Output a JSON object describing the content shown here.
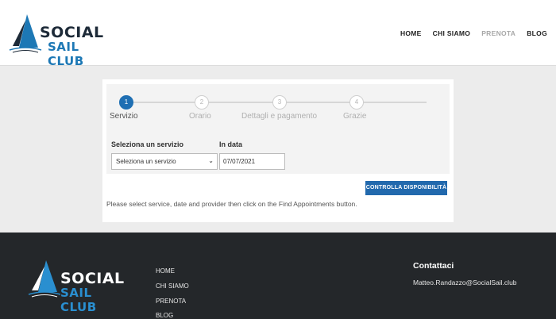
{
  "header": {
    "logo_line1": "SOCIAL",
    "logo_line2": "SAIL CLUB",
    "nav": [
      "HOME",
      "CHI SIAMO",
      "PRENOTA",
      "BLOG"
    ],
    "active_nav": "PRENOTA"
  },
  "wizard": {
    "steps": [
      {
        "number": "1",
        "label": "Servizio"
      },
      {
        "number": "2",
        "label": "Orario"
      },
      {
        "number": "3",
        "label": "Dettagli e pagamento"
      },
      {
        "number": "4",
        "label": "Grazie"
      }
    ],
    "active_step": "1",
    "service_label": "Seleziona un servizio",
    "service_value": "Seleziona un servizio",
    "date_label": "In data",
    "date_value": "07/07/2021",
    "check_button": "CONTROLLA DISPONIBILITÀ",
    "hint": "Please select service, date and provider then click on the Find Appointments button."
  },
  "footer": {
    "logo_line1": "SOCIAL",
    "logo_line2": "SAIL CLUB",
    "nav": [
      "HOME",
      "CHI SIAMO",
      "PRENOTA",
      "BLOG"
    ],
    "contact_title": "Contattaci",
    "contact_email": "Matteo.Randazzo@SocialSail.club"
  },
  "colors": {
    "brand_navy": "#1d2a38",
    "brand_blue": "#1d78b5",
    "button_blue": "#2269ad",
    "footer_bg": "#24272a"
  }
}
